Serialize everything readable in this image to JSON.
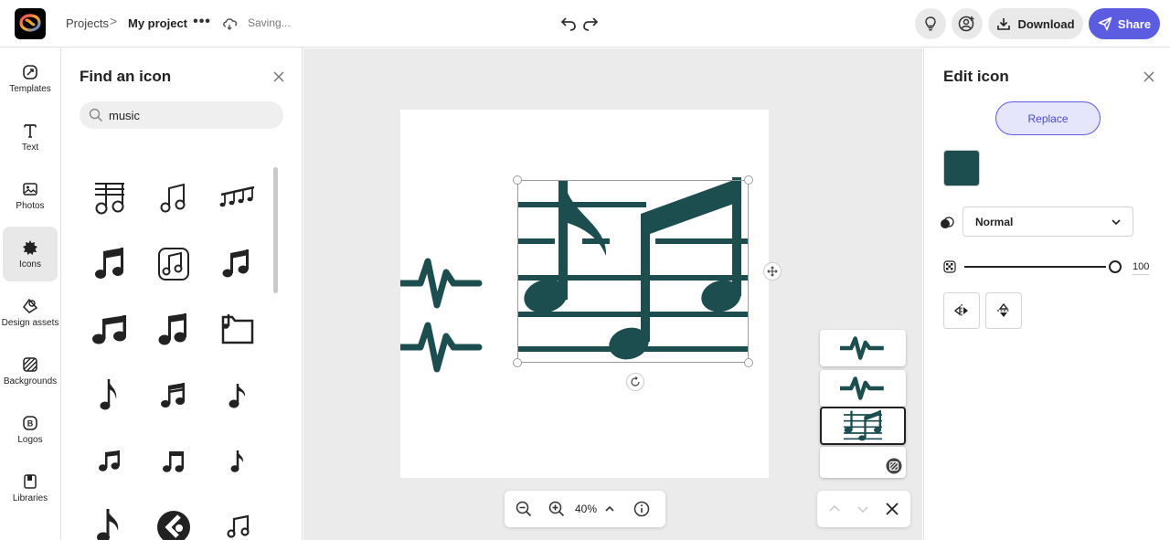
{
  "topbar": {
    "breadcrumb_root": "Projects",
    "breadcrumb_sep": ">",
    "project_name": "My project",
    "more": "•••",
    "status": "Saving...",
    "download_label": "Download",
    "share_label": "Share"
  },
  "rail": {
    "items": [
      {
        "label": "Templates",
        "icon": "templates-icon"
      },
      {
        "label": "Text",
        "icon": "text-icon"
      },
      {
        "label": "Photos",
        "icon": "photos-icon"
      },
      {
        "label": "Icons",
        "icon": "icons-icon",
        "active": true
      },
      {
        "label": "Design assets",
        "icon": "design-assets-icon"
      },
      {
        "label": "Backgrounds",
        "icon": "backgrounds-icon"
      },
      {
        "label": "Logos",
        "icon": "logos-icon"
      },
      {
        "label": "Libraries",
        "icon": "libraries-icon"
      }
    ]
  },
  "find_panel": {
    "title": "Find an icon",
    "search_value": "music",
    "results": [
      "music-sheet-outline-icon",
      "music-note-outline-icon",
      "music-notes-staff-icon",
      "beamed-notes-icon",
      "music-file-outline-icon",
      "beamed-notes-solid-icon",
      "beamed-notes-large-icon",
      "beamed-notes-square-icon",
      "music-folder-icon",
      "eighth-note-icon",
      "sixteenth-notes-icon",
      "quarter-note-icon",
      "beamed-eighth-notes-icon",
      "beamed-notes-small-icon",
      "quarter-note-small-icon",
      "eighth-note-large-icon",
      "music-badge-icon",
      "beamed-notes-outline-icon"
    ]
  },
  "canvas": {
    "zoom": "40%",
    "layers": [
      "pulse-layer",
      "pulse-layer",
      "music-notes-layer",
      "background-layer"
    ]
  },
  "edit_panel": {
    "title": "Edit icon",
    "replace_label": "Replace",
    "color": "#1c4d4f",
    "blend_mode": "Normal",
    "opacity": "100"
  },
  "colors": {
    "accent": "#5c5ce0",
    "icon_teal": "#1c4d4f"
  }
}
